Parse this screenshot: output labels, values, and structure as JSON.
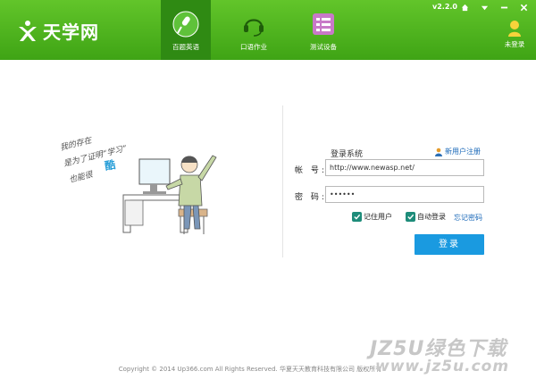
{
  "app": {
    "logo_text": "天学网",
    "version": "v2.2.0"
  },
  "nav": {
    "tabs": [
      {
        "label": "百题英语",
        "icon": "microphone-icon",
        "active": true
      },
      {
        "label": "口语作业",
        "icon": "headset-icon",
        "active": false
      },
      {
        "label": "测试设备",
        "icon": "checklist-icon",
        "active": false
      }
    ]
  },
  "window_controls": [
    "home-icon",
    "menu-icon",
    "minimize-icon",
    "close-icon"
  ],
  "user": {
    "status_label": "未登录"
  },
  "illustration": {
    "handwritten_lines": [
      "我的存在",
      "是为了证明“学习”",
      "也能很",
      "酷"
    ]
  },
  "login": {
    "title": "登录系统",
    "register_link": "新用户注册",
    "account_label": "帐 号:",
    "account_value": "http://www.newasp.net/",
    "password_label": "密 码:",
    "password_value": "••••••",
    "remember_label": "记住用户",
    "auto_login_label": "自动登录",
    "forgot_link": "忘记密码",
    "submit_label": "登录"
  },
  "footer": {
    "copyright": "Copyright © 2014 Up366.com All Rights Reserved. 华夏天天教育科技有限公司 版权所有"
  },
  "watermark": {
    "line1": "JZ5U绿色下载",
    "line2": "www.jz5u.com"
  },
  "colors": {
    "header_green": "#4bb41f",
    "active_tab": "#2f8a13",
    "login_button": "#1a9ae0",
    "checkbox": "#1e8c7a",
    "link": "#1a68b8"
  }
}
